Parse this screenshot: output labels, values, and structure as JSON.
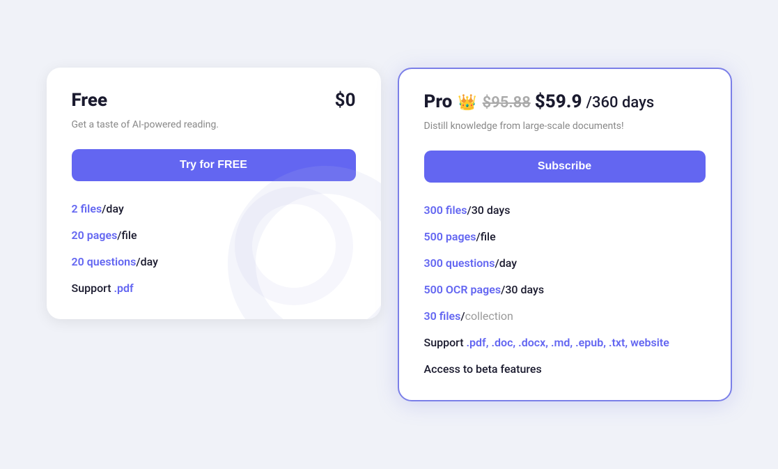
{
  "free_card": {
    "title": "Free",
    "price": "$0",
    "description": "Get a taste of AI-powered reading.",
    "button_label": "Try for FREE",
    "features": [
      {
        "highlight": "2 files",
        "separator": "/",
        "rest": "day"
      },
      {
        "highlight": "20 pages",
        "separator": "/",
        "rest": "file"
      },
      {
        "highlight": "20 questions",
        "separator": "/",
        "rest": "day"
      },
      {
        "prefix": "Support ",
        "highlight": ".pdf",
        "rest": ""
      }
    ]
  },
  "pro_card": {
    "title": "Pro",
    "crown": "👑",
    "price_original": "$95.88",
    "price_current": "$59.9",
    "price_period": "/360 days",
    "description": "Distill knowledge from large-scale documents!",
    "button_label": "Subscribe",
    "features": [
      {
        "highlight": "300 files",
        "separator": "/",
        "rest": "30 days"
      },
      {
        "highlight": "500 pages",
        "separator": "/",
        "rest": "file"
      },
      {
        "highlight": "300 questions",
        "separator": "/",
        "rest": "day"
      },
      {
        "highlight": "500 OCR pages",
        "separator": "/",
        "rest": "30 days"
      },
      {
        "highlight": "30 files",
        "separator": "/",
        "rest_muted": "collection"
      },
      {
        "prefix": "Support ",
        "highlights": ".pdf, .doc, .docx, .md, .epub, .txt, website",
        "rest": ""
      },
      {
        "prefix": "Access to beta features",
        "highlights": "",
        "rest": ""
      }
    ]
  },
  "colors": {
    "accent": "#6366f1",
    "text_dark": "#1a1a2e",
    "text_muted": "#888"
  }
}
